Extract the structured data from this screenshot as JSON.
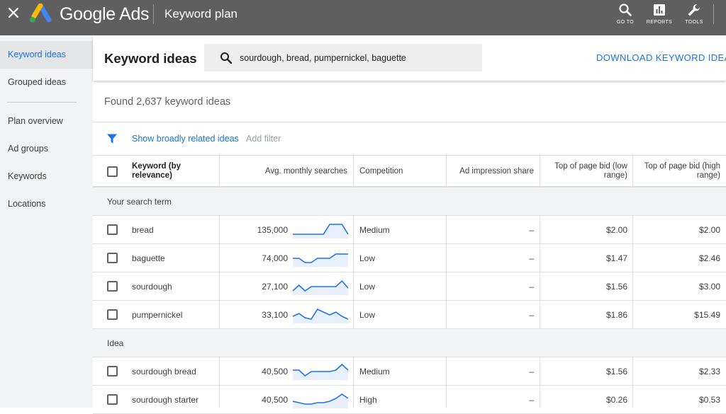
{
  "topbar": {
    "brand": "Google Ads",
    "page_title": "Keyword plan",
    "tools": [
      {
        "label": "GO TO",
        "icon": "search-icon"
      },
      {
        "label": "REPORTS",
        "icon": "reports-icon"
      },
      {
        "label": "TOOLS",
        "icon": "wrench-icon"
      }
    ]
  },
  "sidebar": {
    "items": [
      {
        "label": "Keyword ideas",
        "active": true
      },
      {
        "label": "Grouped ideas",
        "active": false
      },
      {
        "label": "Plan overview",
        "active": false
      },
      {
        "label": "Ad groups",
        "active": false
      },
      {
        "label": "Keywords",
        "active": false
      },
      {
        "label": "Locations",
        "active": false
      }
    ]
  },
  "header": {
    "title": "Keyword ideas",
    "search_value": "sourdough, bread, pumpernickel, baguette",
    "download_label": "DOWNLOAD KEYWORD IDEAS"
  },
  "summary": {
    "found_text": "Found 2,637 keyword ideas",
    "filter_link": "Show broadly related ideas",
    "add_filter": "Add filter"
  },
  "table": {
    "columns": {
      "keyword": "Keyword (by relevance)",
      "searches": "Avg. monthly searches",
      "competition": "Competition",
      "impression_share": "Ad impression share",
      "bid_low": "Top of page bid (low range)",
      "bid_high": "Top of page bid (high range)"
    },
    "groups": [
      {
        "label": "Your search term",
        "rows": [
          {
            "keyword": "bread",
            "searches": "135,000",
            "competition": "Medium",
            "impression_share": "–",
            "bid_low": "$2.00",
            "bid_high": "$2.00",
            "trend": [
              2,
              2,
              2,
              2,
              2,
              2,
              9,
              9,
              9,
              2
            ]
          },
          {
            "keyword": "baguette",
            "searches": "74,000",
            "competition": "Low",
            "impression_share": "–",
            "bid_low": "$1.47",
            "bid_high": "$2.46",
            "trend": [
              5,
              5,
              2,
              2,
              5,
              5,
              5,
              8,
              8,
              8
            ]
          },
          {
            "keyword": "sourdough",
            "searches": "27,100",
            "competition": "Low",
            "impression_share": "–",
            "bid_low": "$1.56",
            "bid_high": "$3.00",
            "trend": [
              2,
              6,
              2,
              5,
              5,
              5,
              5,
              5,
              9,
              4
            ]
          },
          {
            "keyword": "pumpernickel",
            "searches": "33,100",
            "competition": "Low",
            "impression_share": "–",
            "bid_low": "$1.86",
            "bid_high": "$15.49",
            "trend": [
              4,
              6,
              3,
              2,
              9,
              7,
              5,
              7,
              4,
              2
            ]
          }
        ]
      },
      {
        "label": "Idea",
        "rows": [
          {
            "keyword": "sourdough bread",
            "searches": "40,500",
            "competition": "Medium",
            "impression_share": "–",
            "bid_low": "$1.56",
            "bid_high": "$2.33",
            "trend": [
              6,
              6,
              2,
              5,
              5,
              5,
              5,
              6,
              10,
              6
            ]
          },
          {
            "keyword": "sourdough starter",
            "searches": "40,500",
            "competition": "High",
            "impression_share": "–",
            "bid_low": "$0.26",
            "bid_high": "$0.53",
            "trend": [
              4,
              3,
              2,
              2,
              3,
              3,
              4,
              6,
              9,
              6
            ]
          }
        ]
      }
    ]
  },
  "colors": {
    "accent": "#1a73e8",
    "topbar": "#5f5f5f",
    "sidebar": "#f1f3f4",
    "spark_fill": "#e8f0fe"
  }
}
